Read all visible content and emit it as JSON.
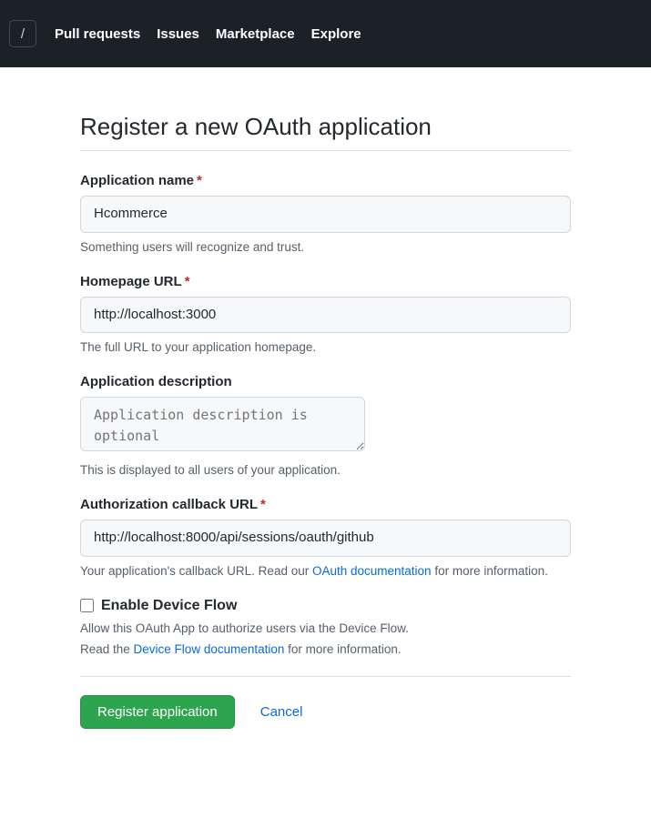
{
  "nav": {
    "logo_glyph": "/",
    "items": [
      "Pull requests",
      "Issues",
      "Marketplace",
      "Explore"
    ]
  },
  "page": {
    "title": "Register a new OAuth application"
  },
  "form": {
    "app_name": {
      "label": "Application name",
      "value": "Hcommerce",
      "hint": "Something users will recognize and trust."
    },
    "homepage": {
      "label": "Homepage URL",
      "value": "http://localhost:3000",
      "hint": "The full URL to your application homepage."
    },
    "description": {
      "label": "Application description",
      "value": "",
      "placeholder": "Application description is optional",
      "hint": "This is displayed to all users of your application."
    },
    "callback": {
      "label": "Authorization callback URL",
      "value": "http://localhost:8000/api/sessions/oauth/github",
      "hint_pre": "Your application's callback URL. Read our ",
      "hint_link": "OAuth documentation",
      "hint_post": " for more information."
    },
    "device_flow": {
      "label": "Enable Device Flow",
      "hint1": "Allow this OAuth App to authorize users via the Device Flow.",
      "hint2_pre": "Read the ",
      "hint2_link": "Device Flow documentation",
      "hint2_post": " for more information."
    },
    "actions": {
      "submit": "Register application",
      "cancel": "Cancel"
    }
  }
}
